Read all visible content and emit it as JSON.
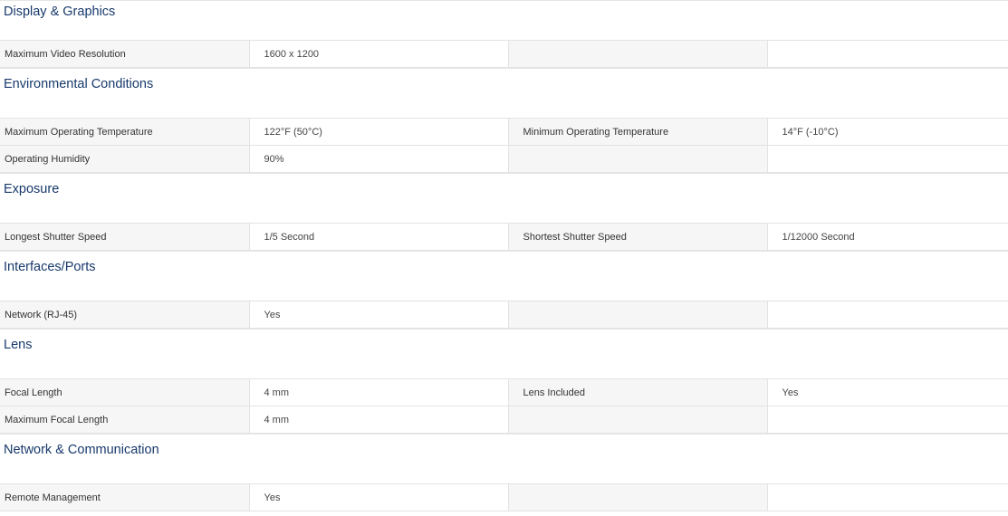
{
  "sections": [
    {
      "title": "Display & Graphics",
      "rows": [
        [
          "Maximum Video Resolution",
          "1600 x 1200",
          "",
          ""
        ]
      ]
    },
    {
      "title": "Environmental Conditions",
      "rows": [
        [
          "Maximum Operating Temperature",
          "122°F (50°C)",
          "Minimum Operating Temperature",
          "14°F (-10°C)"
        ],
        [
          "Operating Humidity",
          "90%",
          "",
          ""
        ]
      ]
    },
    {
      "title": "Exposure",
      "rows": [
        [
          "Longest Shutter Speed",
          "1/5 Second",
          "Shortest Shutter Speed",
          "1/12000 Second"
        ]
      ]
    },
    {
      "title": "Interfaces/Ports",
      "rows": [
        [
          "Network (RJ-45)",
          "Yes",
          "",
          ""
        ]
      ]
    },
    {
      "title": "Lens",
      "rows": [
        [
          "Focal Length",
          "4 mm",
          "Lens Included",
          "Yes"
        ],
        [
          "Maximum Focal Length",
          "4 mm",
          "",
          ""
        ]
      ]
    },
    {
      "title": "Network & Communication",
      "rows": [
        [
          "Remote Management",
          "Yes",
          "",
          ""
        ]
      ]
    }
  ],
  "colors": {
    "heading": "#17396b",
    "label_bg": "#f6f6f6",
    "border": "#e3e3e3"
  }
}
